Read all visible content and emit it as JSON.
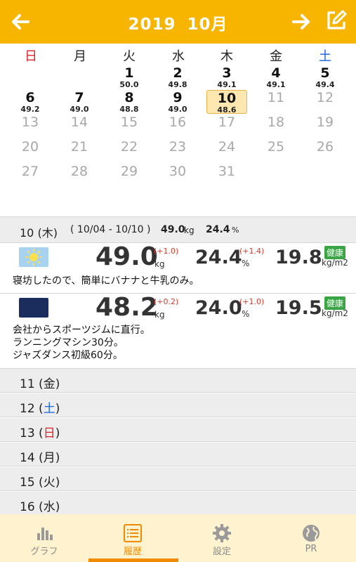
{
  "header": {
    "year": "2019",
    "month": "10月"
  },
  "calendar": {
    "weekdays": [
      "日",
      "月",
      "火",
      "水",
      "木",
      "金",
      "土"
    ],
    "weekday_colors": {
      "sunday": "#e0202a",
      "saturday": "#1565e0"
    },
    "days": [
      {
        "d": "1",
        "w": "50.0"
      },
      {
        "d": "2",
        "w": "49.8"
      },
      {
        "d": "3",
        "w": "49.1"
      },
      {
        "d": "4",
        "w": "49.1"
      },
      {
        "d": "5",
        "w": "49.4"
      },
      {
        "d": "6",
        "w": "49.2"
      },
      {
        "d": "7",
        "w": "49.0"
      },
      {
        "d": "8",
        "w": "48.8"
      },
      {
        "d": "9",
        "w": "49.0"
      },
      {
        "d": "10",
        "w": "48.6"
      },
      {
        "d": "11",
        "w": ""
      },
      {
        "d": "12",
        "w": ""
      },
      {
        "d": "13",
        "w": ""
      },
      {
        "d": "14",
        "w": ""
      },
      {
        "d": "15",
        "w": ""
      },
      {
        "d": "16",
        "w": ""
      },
      {
        "d": "17",
        "w": ""
      },
      {
        "d": "18",
        "w": ""
      },
      {
        "d": "19",
        "w": ""
      },
      {
        "d": "20",
        "w": ""
      },
      {
        "d": "21",
        "w": ""
      },
      {
        "d": "22",
        "w": ""
      },
      {
        "d": "23",
        "w": ""
      },
      {
        "d": "24",
        "w": ""
      },
      {
        "d": "25",
        "w": ""
      },
      {
        "d": "26",
        "w": ""
      },
      {
        "d": "27",
        "w": ""
      },
      {
        "d": "28",
        "w": ""
      },
      {
        "d": "29",
        "w": ""
      },
      {
        "d": "30",
        "w": ""
      },
      {
        "d": "31",
        "w": ""
      }
    ]
  },
  "week_summary": {
    "day": "10 (木)",
    "range": "( 10/04 - 10/10 )",
    "weight": "49.0",
    "weight_unit": "kg",
    "fat": "24.4",
    "fat_unit": "%"
  },
  "entries": {
    "morning": {
      "weight": "49.0",
      "weight_delta": "(+1.0)",
      "weight_unit": "kg",
      "fat": "24.4",
      "fat_delta": "(+1.4)",
      "fat_unit": "%",
      "bmi": "19.8",
      "bmi_unit": "kg/m2",
      "badge": "健康",
      "memo": "寝坊したので、簡単にバナナと牛乳のみ。"
    },
    "evening": {
      "weight": "48.2",
      "weight_delta": "(+0.2)",
      "weight_unit": "kg",
      "fat": "24.0",
      "fat_delta": "(+1.0)",
      "fat_unit": "%",
      "bmi": "19.5",
      "bmi_unit": "kg/m2",
      "badge": "健康",
      "memo": "会社からスポーツジムに直行。\nランニングマシン30分。\nジャズダンス初級60分。"
    }
  },
  "day_rows": [
    {
      "num": "11",
      "open": " (",
      "dow": "金",
      "close": ")",
      "color": ""
    },
    {
      "num": "12",
      "open": " (",
      "dow": "土",
      "close": ")",
      "color": "blue"
    },
    {
      "num": "13",
      "open": " (",
      "dow": "日",
      "close": ")",
      "color": "red"
    },
    {
      "num": "14",
      "open": " (",
      "dow": "月",
      "close": ")",
      "color": ""
    },
    {
      "num": "15",
      "open": " (",
      "dow": "火",
      "close": ")",
      "color": ""
    },
    {
      "num": "16",
      "open": " (",
      "dow": "水",
      "close": ")",
      "color": ""
    }
  ],
  "nav": {
    "graph": "グラフ",
    "history": "履歴",
    "settings": "設定",
    "pr": "PR"
  },
  "colors": {
    "brand": "#f7b500",
    "accent": "#f08a00",
    "badge_green": "#39a544",
    "delta_red": "#d63a2b"
  }
}
